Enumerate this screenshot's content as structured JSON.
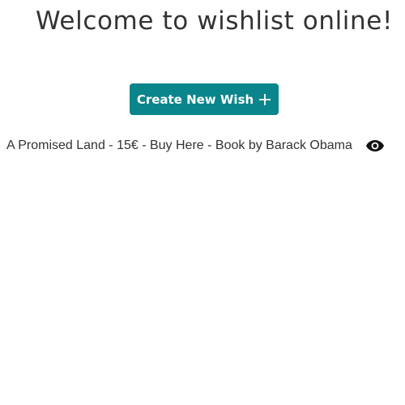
{
  "header": {
    "title": "Welcome to wishlist online!"
  },
  "actions": {
    "create_label": "Create New Wish",
    "create_icon": "plus-icon",
    "accent_color": "#0b858c"
  },
  "wishes": [
    {
      "text": "A Promised Land - 15€ - Buy Here - Book by Barack Obama",
      "view_icon": "eye-icon"
    }
  ]
}
